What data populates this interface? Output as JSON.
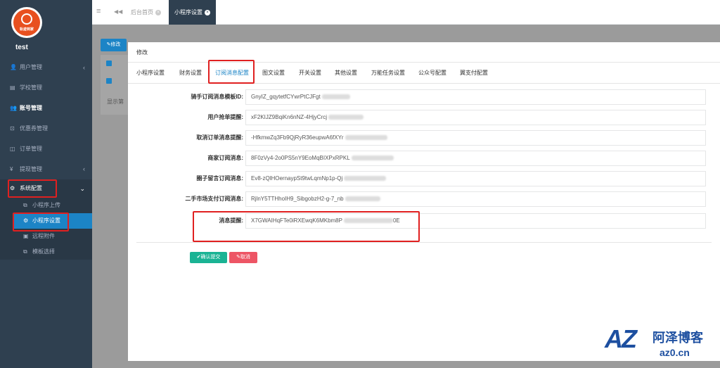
{
  "sidebar": {
    "logo_text": "轨迹到家",
    "username": "test",
    "items": [
      {
        "icon": "user-icon",
        "glyph": "👤",
        "label": "用户管理",
        "arrow": "‹"
      },
      {
        "icon": "book-icon",
        "glyph": "▤",
        "label": "学校管理",
        "arrow": ""
      },
      {
        "icon": "users-icon",
        "glyph": "👥",
        "label": "账号管理",
        "arrow": ""
      },
      {
        "icon": "coupon-icon",
        "glyph": "⊡",
        "label": "优惠券管理",
        "arrow": ""
      },
      {
        "icon": "order-icon",
        "glyph": "◫",
        "label": "订单管理",
        "arrow": ""
      },
      {
        "icon": "yen-icon",
        "glyph": "¥",
        "label": "提现管理",
        "arrow": "‹"
      },
      {
        "icon": "gear-icon",
        "glyph": "⚙",
        "label": "系统配置",
        "arrow": "⌄"
      }
    ],
    "sub_items": [
      {
        "icon": "copy-icon",
        "glyph": "⧉",
        "label": "小程序上传"
      },
      {
        "icon": "gear-icon",
        "glyph": "⚙",
        "label": "小程序设置"
      },
      {
        "icon": "image-icon",
        "glyph": "▣",
        "label": "远程附件"
      },
      {
        "icon": "copy-icon",
        "glyph": "⧉",
        "label": "模板选择"
      }
    ]
  },
  "topbar": {
    "menu_glyph": "≡",
    "back_glyph": "◀◀",
    "tabs": [
      {
        "label": "后台首页",
        "close": "×"
      },
      {
        "label": "小程序设置",
        "close": "×"
      }
    ]
  },
  "background": {
    "edit_button": "✎修改",
    "row_text": "显示第"
  },
  "modal": {
    "title": "修改",
    "tabs": [
      "小程序设置",
      "财务设置",
      "订阅消息配置",
      "图文设置",
      "开关设置",
      "其他设置",
      "万能任务设置",
      "公众号配置",
      "翼支付配置"
    ],
    "active_tab": "订阅消息配置",
    "fields": [
      {
        "label": "骑手订阅消息模板ID:",
        "value": "GnyIZ_gqytetfCYwrPtCJFgt"
      },
      {
        "label": "用户抢单提醒:",
        "value": "xF2KIJZ9BqiKn6nNZ-4HjyCrcj"
      },
      {
        "label": "取消订单消息提醒:",
        "value": "-HfkmwZq3Fb9QjRyR36eupwA6fXYr"
      },
      {
        "label": "商家订阅消息:",
        "value": "8F0zVy4-2o0PS5nY9EoMqBIXPxRPKL"
      },
      {
        "label": "圈子留言订阅消息:",
        "value": "Ev8-zQlHOernaypSt9twLqmNp1p-Qj"
      },
      {
        "label": "二手市场支付订阅消息:",
        "value": "RjlnY5TTHhoIH9_SibgobzH2-g-7_nb"
      },
      {
        "label": "消息提醒:",
        "value": "X7GWAIHqFTe0iRXEwqK6MKbm8P",
        "value_tail": "0E"
      }
    ],
    "confirm_button": "✔确认提交",
    "cancel_button": "✎取消"
  },
  "watermark": {
    "logo": "AZ",
    "name": "阿泽博客",
    "url": "az0.cn"
  }
}
